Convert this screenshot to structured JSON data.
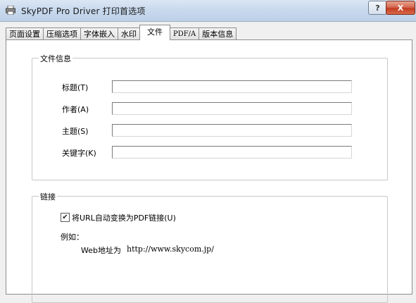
{
  "window": {
    "title": "SkyPDF Pro Driver 打印首选项",
    "help_glyph": "?",
    "close_glyph": "X"
  },
  "tabs": [
    {
      "label": "页面设置"
    },
    {
      "label": "压缩选项"
    },
    {
      "label": "字体嵌入"
    },
    {
      "label": "水印"
    },
    {
      "label": "文件",
      "active": true
    },
    {
      "label": "PDF/A"
    },
    {
      "label": "版本信息"
    }
  ],
  "file_info": {
    "title": "文件信息",
    "fields": [
      {
        "label": "标题(T)",
        "value": ""
      },
      {
        "label": "作者(A)",
        "value": ""
      },
      {
        "label": "主题(S)",
        "value": ""
      },
      {
        "label": "关键字(K)",
        "value": ""
      }
    ]
  },
  "links": {
    "title": "链接",
    "checkbox_label": "将URL自动变换为PDF链接(U)",
    "checkbox_checked": true,
    "checkmark": "✔",
    "example_label": "例如：",
    "example_prefix": "Web地址为",
    "example_url": "http://www.skycom.jp/"
  },
  "colors": {
    "close_button": "#c23d22",
    "titlebar": "#c9daee"
  },
  "icons": [
    "printer-icon",
    "help-icon",
    "close-icon",
    "checkmark-icon"
  ]
}
